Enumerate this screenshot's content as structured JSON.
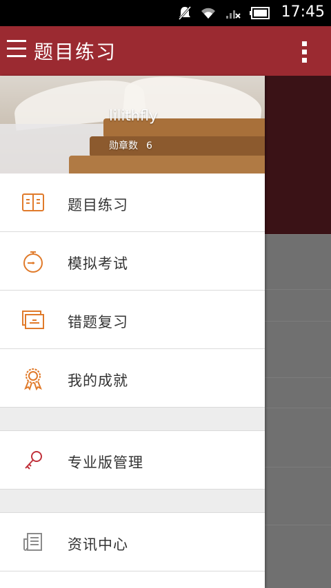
{
  "status_bar": {
    "time": "17:45",
    "icons": [
      "notifications-muted-icon",
      "wifi-icon",
      "signal-no-service-icon",
      "battery-icon"
    ]
  },
  "app_bar": {
    "title": "题目练习",
    "menu_icon": "hamburger-menu-icon",
    "overflow_icon": "more-vertical-icon"
  },
  "drawer": {
    "header": {
      "username": "lilithfly",
      "badges_label": "勋章数",
      "badges_count": "6"
    },
    "items": [
      {
        "label": "题目练习",
        "icon": "open-book-icon"
      },
      {
        "label": "模拟考试",
        "icon": "stopwatch-icon"
      },
      {
        "label": "错题复习",
        "icon": "stacked-cards-icon"
      },
      {
        "label": "我的成就",
        "icon": "award-medal-icon"
      },
      {
        "label": "专业版管理",
        "icon": "key-icon"
      },
      {
        "label": "资讯中心",
        "icon": "newspaper-icon"
      }
    ]
  },
  "colors": {
    "app_bar": "#9b2a31",
    "accent_orange": "#e07a2a",
    "key_red": "#c0303a",
    "icon_gray": "#8a8a8a"
  }
}
